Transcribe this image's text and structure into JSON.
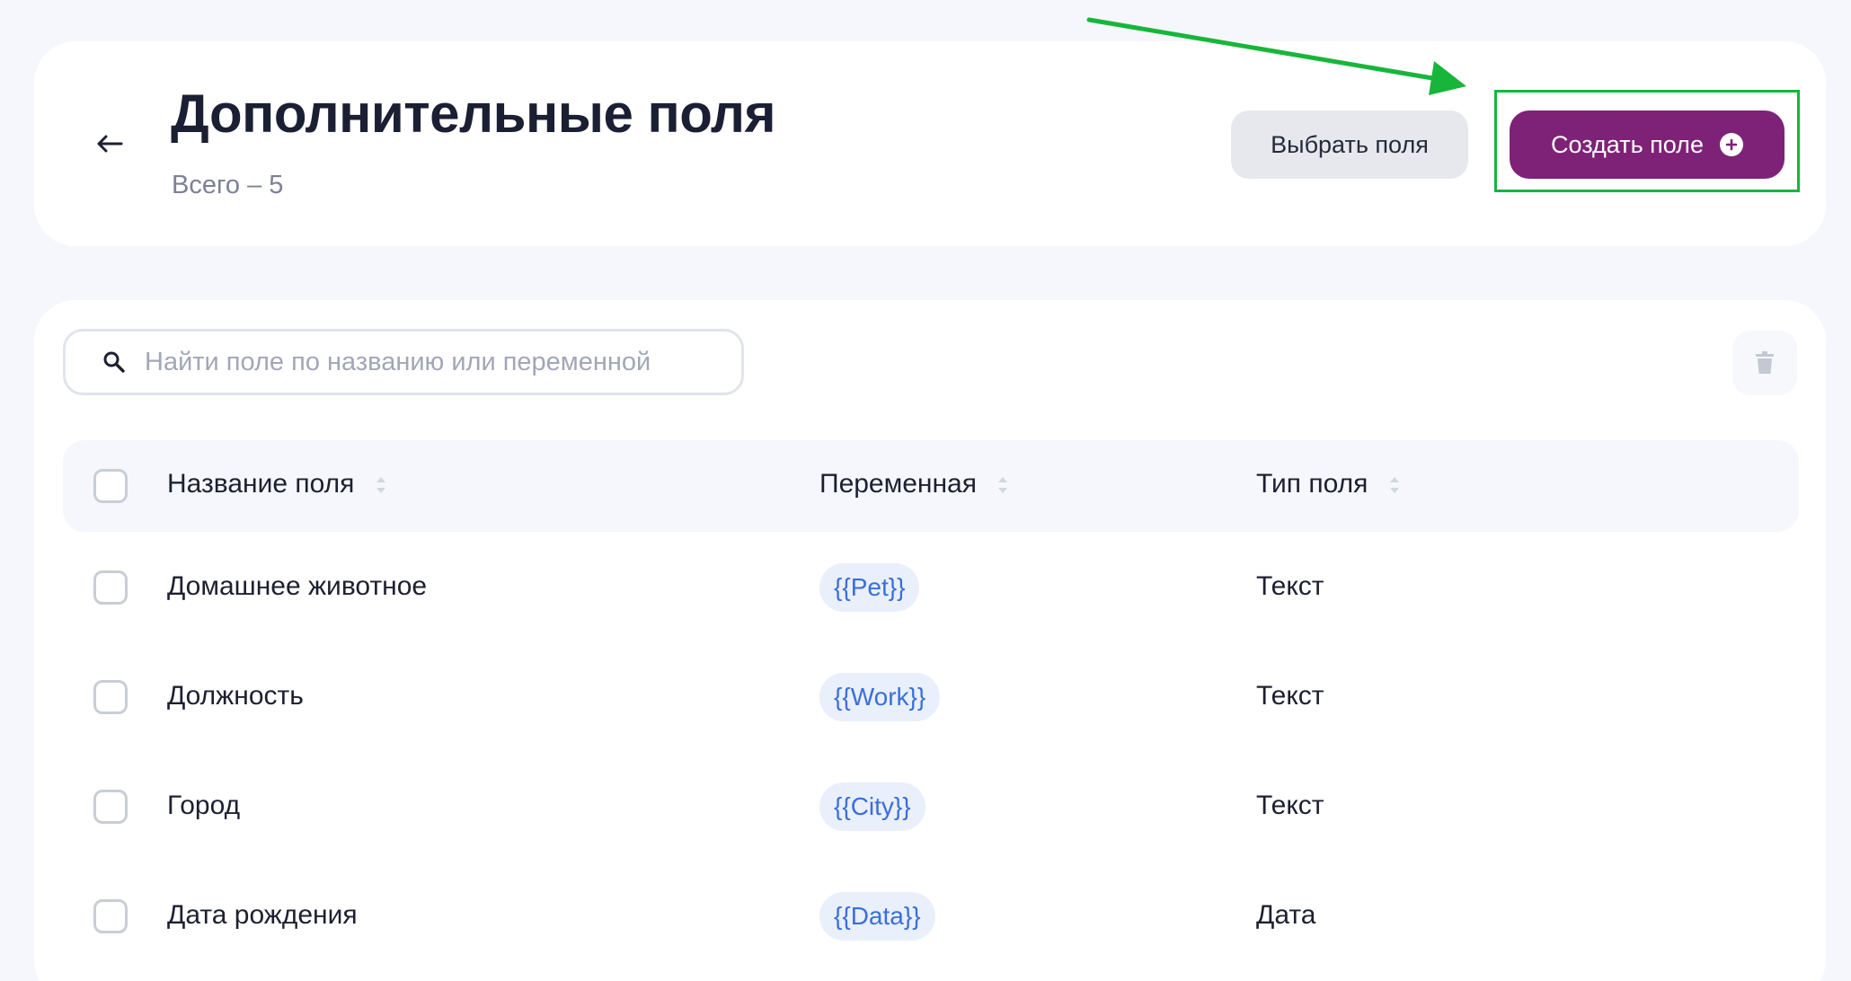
{
  "header": {
    "title": "Дополнительные поля",
    "subtitle": "Всего – 5",
    "select_fields_label": "Выбрать поля",
    "create_field_label": "Создать поле"
  },
  "search": {
    "placeholder": "Найти поле по названию или переменной"
  },
  "table": {
    "columns": [
      "Название поля",
      "Переменная",
      "Тип поля"
    ],
    "rows": [
      {
        "name": "Домашнее животное",
        "variable": "{{Pet}}",
        "type": "Текст"
      },
      {
        "name": "Должность",
        "variable": "{{Work}}",
        "type": "Текст"
      },
      {
        "name": "Город",
        "variable": "{{City}}",
        "type": "Текст"
      },
      {
        "name": "Дата рождения",
        "variable": "{{Data}}",
        "type": "Дата"
      }
    ]
  },
  "colors": {
    "accent": "#7e2277",
    "highlight": "#17b63a",
    "chip_bg": "#e9effb",
    "chip_text": "#3a6fd8"
  },
  "icons": {
    "back": "arrow-left-icon",
    "search": "search-icon",
    "trash": "trash-icon",
    "plus": "plus-circle-icon",
    "sort": "sort-icon"
  }
}
